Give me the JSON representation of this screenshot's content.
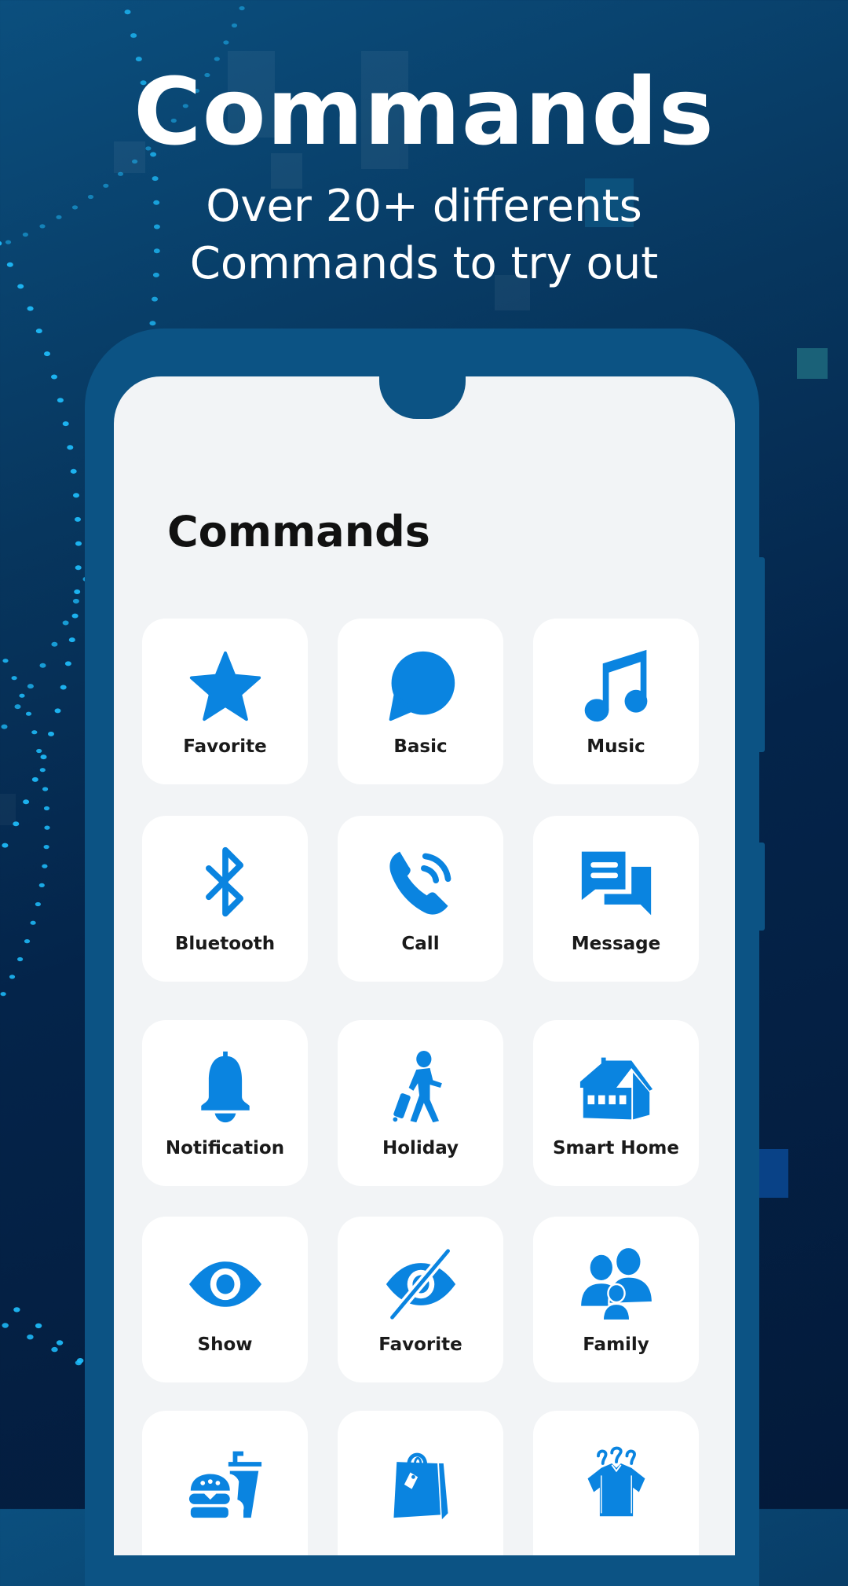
{
  "header": {
    "title": "Commands",
    "subtitle_line1": "Over 20+ differents",
    "subtitle_line2": "Commands to try out"
  },
  "screen": {
    "title": "Commands"
  },
  "colors": {
    "accent": "#0a84e0",
    "frame": "#0c5384",
    "screen_bg": "#f2f4f6",
    "tile_bg": "#ffffff",
    "dots": "#1fc0ff"
  },
  "commands": [
    {
      "label": "Favorite",
      "icon": "star-icon"
    },
    {
      "label": "Basic",
      "icon": "chat-bubble-icon"
    },
    {
      "label": "Music",
      "icon": "music-note-icon"
    },
    {
      "label": "Bluetooth",
      "icon": "bluetooth-icon"
    },
    {
      "label": "Call",
      "icon": "phone-call-icon"
    },
    {
      "label": "Message",
      "icon": "messages-icon"
    },
    {
      "label": "Notification",
      "icon": "bell-icon"
    },
    {
      "label": "Holiday",
      "icon": "traveler-icon"
    },
    {
      "label": "Smart Home",
      "icon": "house-icon"
    },
    {
      "label": "Show",
      "icon": "eye-icon"
    },
    {
      "label": "Favorite",
      "icon": "eye-off-icon"
    },
    {
      "label": "Family",
      "icon": "family-icon"
    },
    {
      "label": "",
      "icon": "fast-food-icon"
    },
    {
      "label": "",
      "icon": "shopping-bag-icon"
    },
    {
      "label": "",
      "icon": "clothes-icon"
    }
  ]
}
